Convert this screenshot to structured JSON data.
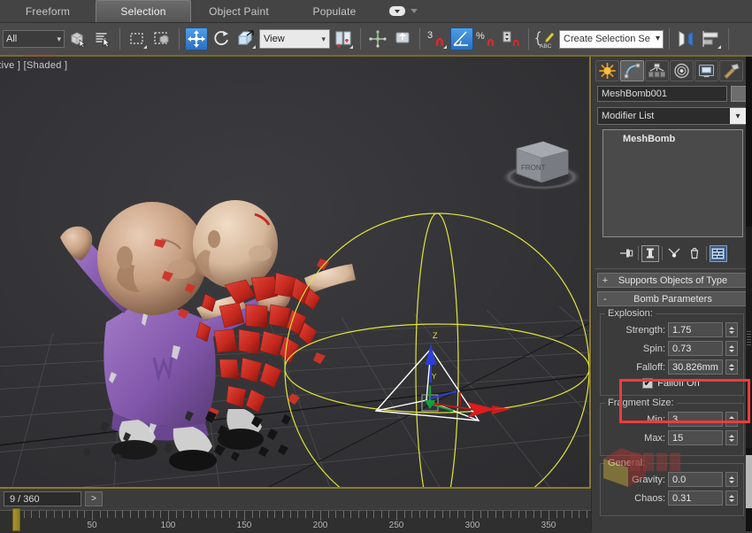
{
  "ribbon": {
    "tabs": [
      {
        "label": "Freeform",
        "active": false
      },
      {
        "label": "Selection",
        "active": true
      },
      {
        "label": "Object Paint",
        "active": false
      },
      {
        "label": "Populate",
        "active": false
      }
    ],
    "overflow_icon": "dropdown-icon",
    "more_icon": "chevron-down-icon"
  },
  "toolbar": {
    "selection_filter": {
      "value": "All",
      "icon": "chevron-down-icon"
    },
    "buttons": [
      {
        "name": "select-object",
        "icon": "cube-select-icon",
        "active": false
      },
      {
        "name": "select-by-name",
        "icon": "list-select-icon",
        "active": false
      },
      {
        "name": "rectangular-selection-region",
        "icon": "marquee-icon",
        "active": false
      },
      {
        "name": "window-crossing",
        "icon": "window-crossing-icon",
        "active": false
      },
      {
        "name": "select-and-move",
        "icon": "move-gizmo-icon",
        "active": true
      },
      {
        "name": "select-and-rotate",
        "icon": "rotate-gizmo-icon",
        "active": false
      },
      {
        "name": "select-and-scale",
        "icon": "scale-gizmo-icon",
        "active": false
      }
    ],
    "reference_coord_system": {
      "value": "View",
      "icon": "chevron-down-icon"
    },
    "pivot_buttons": [
      {
        "name": "use-pivot-point-center",
        "icon": "pivot-center-icon"
      },
      {
        "name": "use-selection-center",
        "icon": "selection-center-icon"
      }
    ],
    "mirror_buttons": [
      {
        "name": "select-and-manipulate",
        "icon": "manipulate-icon"
      },
      {
        "name": "snaps-toggle-3d",
        "icon": "magnet-3-icon",
        "label": "3"
      },
      {
        "name": "angle-snap-toggle",
        "icon": "angle-snap-icon",
        "active": true
      },
      {
        "name": "percent-snap-toggle",
        "icon": "percent-snap-icon",
        "label": "%"
      },
      {
        "name": "spinner-snap-toggle",
        "icon": "spinner-snap-icon"
      },
      {
        "name": "edit-named-selection-sets",
        "icon": "named-set-edit-icon"
      }
    ],
    "selection_set": {
      "value": "Create Selection Se",
      "placeholder": "Create Selection Set",
      "icon": "chevron-down-icon"
    },
    "right_buttons": [
      {
        "name": "mirror",
        "icon": "mirror-icon"
      },
      {
        "name": "align",
        "icon": "align-icon"
      }
    ]
  },
  "viewport": {
    "label": "ective ] [Shaded ]",
    "viewcube_label": "FRONT",
    "gizmo_axis_z": "Z",
    "gizmo_axis_y": "Y",
    "colors": {
      "background": "#333336",
      "gizmo_falloff": "#e3e33a",
      "border": "#8a7a2e",
      "robe_purple": "#8a5fae",
      "robe_red": "#cc2a20"
    }
  },
  "trackbar": {
    "current_frame": "9 / 360",
    "next_button": ">",
    "ruler_labels": [
      "50",
      "100",
      "150",
      "200",
      "250",
      "300",
      "350"
    ]
  },
  "command_panel": {
    "tabs": [
      {
        "name": "create",
        "icon": "star-create-icon",
        "active": false
      },
      {
        "name": "modify",
        "icon": "modify-curve-icon",
        "active": true
      },
      {
        "name": "hierarchy",
        "icon": "hierarchy-icon",
        "active": false
      },
      {
        "name": "motion",
        "icon": "motion-wheel-icon",
        "active": false
      },
      {
        "name": "display",
        "icon": "display-monitor-icon",
        "active": false
      },
      {
        "name": "utilities",
        "icon": "hammer-utilities-icon",
        "active": false
      }
    ],
    "object_name": "MeshBomb001",
    "modifier_list_label": "Modifier List",
    "stack_items": [
      "MeshBomb"
    ],
    "stack_buttons": [
      {
        "name": "pin-stack",
        "icon": "pin-icon"
      },
      {
        "name": "show-end-result",
        "icon": "show-end-result-icon"
      },
      {
        "name": "make-unique",
        "icon": "make-unique-icon"
      },
      {
        "name": "remove-modifier",
        "icon": "trash-modifier-icon"
      },
      {
        "name": "configure-modifier-sets",
        "icon": "configure-sets-icon"
      }
    ],
    "rollouts": [
      {
        "name": "supports-objects-of-type",
        "title": "Supports Objects of Type",
        "state": "+"
      },
      {
        "name": "bomb-parameters",
        "title": "Bomb Parameters",
        "state": "-"
      }
    ],
    "groups": {
      "explosion": {
        "title": "Explosion:",
        "params": [
          {
            "name": "strength",
            "label": "Strength:",
            "value": "1.75"
          },
          {
            "name": "spin",
            "label": "Spin:",
            "value": "0.73"
          },
          {
            "name": "falloff",
            "label": "Falloff:",
            "value": "30.826mm",
            "highlighted": true
          }
        ],
        "checkbox": {
          "name": "falloff-on",
          "label": "Falloff On",
          "checked": true
        }
      },
      "fragment_size": {
        "title": "Fragment Size:",
        "params": [
          {
            "name": "min",
            "label": "Min:",
            "value": "3"
          },
          {
            "name": "max",
            "label": "Max:",
            "value": "15"
          }
        ]
      },
      "general": {
        "title": "General:",
        "params": [
          {
            "name": "gravity",
            "label": "Gravity:",
            "value": "0.0"
          },
          {
            "name": "chaos",
            "label": "Chaos:",
            "value": "0.31"
          }
        ]
      }
    },
    "highlight_color": "#ef3b3b"
  },
  "watermark": {
    "text": "www.",
    "logo": "cube-logo-watermark"
  }
}
